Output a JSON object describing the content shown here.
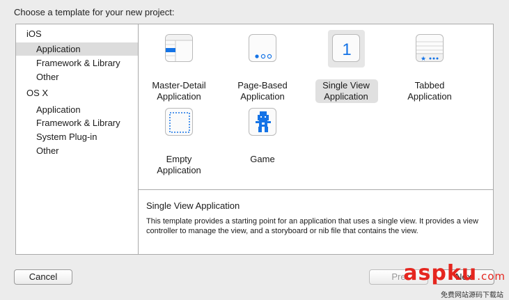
{
  "heading": "Choose a template for your new project:",
  "sidebar": {
    "groups": [
      {
        "title": "iOS",
        "items": [
          "Application",
          "Framework & Library",
          "Other"
        ]
      },
      {
        "title": "OS X",
        "items": [
          "Application",
          "Framework & Library",
          "System Plug-in",
          "Other"
        ]
      }
    ],
    "selected": "iOS/Application"
  },
  "templates": [
    {
      "line1": "Master-Detail",
      "line2": "Application",
      "icon": "master-detail-icon"
    },
    {
      "line1": "Page-Based",
      "line2": "Application",
      "icon": "page-based-icon"
    },
    {
      "line1": "Single View",
      "line2": "Application",
      "icon": "single-view-icon",
      "glyph": "1",
      "selected": true
    },
    {
      "line1": "Tabbed",
      "line2": "Application",
      "icon": "tabbed-icon"
    },
    {
      "line1": "Empty",
      "line2": "Application",
      "icon": "empty-icon"
    },
    {
      "line1": "Game",
      "line2": "",
      "icon": "game-icon"
    }
  ],
  "description": {
    "title": "Single View Application",
    "text": "This template provides a starting point for an application that uses a single view. It provides a view controller to manage the view, and a storyboard or nib file that contains the view."
  },
  "buttons": {
    "cancel": "Cancel",
    "previous": "Pre",
    "next": "Next"
  },
  "watermark": {
    "brand": "asp",
    "suffix": "ku",
    "domain": ".com",
    "subtitle": "免费网站源码下载站"
  },
  "colors": {
    "accent": "#1473e6",
    "watermark": "#e5261f"
  }
}
